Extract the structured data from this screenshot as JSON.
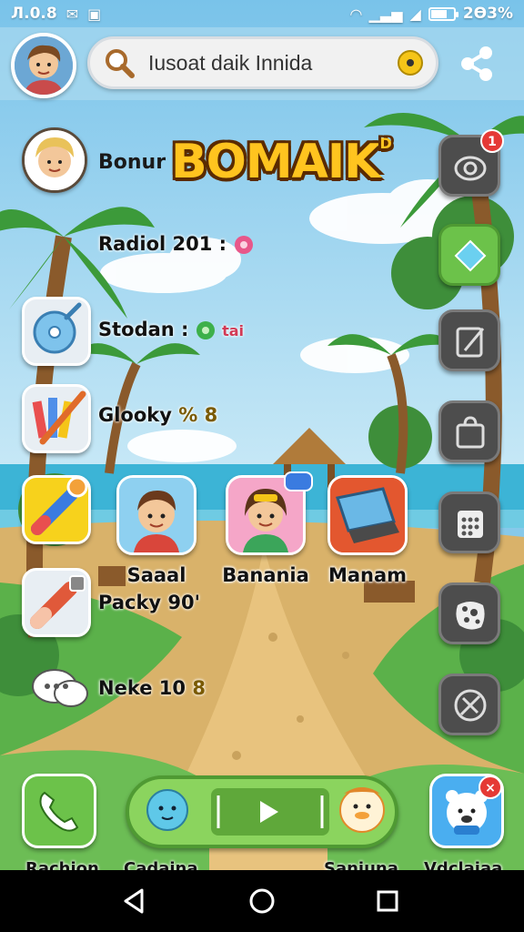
{
  "status_bar": {
    "time": "Л.0.8",
    "battery_text": "2Ѳ3%",
    "battery_level": 0.65,
    "icons": [
      "chat-icon",
      "app-icon",
      "wifi-icon",
      "signal-icon",
      "signal-icon",
      "battery-icon"
    ]
  },
  "header": {
    "search_text": "Iusoat daik Innida",
    "icons": [
      "user-avatar",
      "search-icon",
      "location-pin-icon",
      "share-icon"
    ]
  },
  "profile": {
    "name": "Bonur",
    "title": "BOMAIK",
    "title_mark": "D"
  },
  "stats": [
    {
      "label": "Radiol 201 :",
      "icon": "donut-icon"
    },
    {
      "label": "Stodan :",
      "icon": "green-orb-icon",
      "suffix": "tai"
    },
    {
      "label": "Glooky",
      "suffix": "% 8"
    },
    {
      "label": "Packy 90'"
    },
    {
      "label": "Neke 10",
      "suffix": "8"
    }
  ],
  "apps": [
    {
      "label": "Saaal",
      "icon": "boy-icon"
    },
    {
      "label": "Banania",
      "icon": "girl-icon"
    },
    {
      "label": "Manam",
      "icon": "laptop-icon"
    }
  ],
  "left_tiles": [
    "disc-icon",
    "crayons-icon",
    "crayon-icon",
    "eraser-icon"
  ],
  "rail": {
    "icons": [
      "camera-icon",
      "diamond-icon",
      "board-icon",
      "bag-icon",
      "calendar-icon",
      "map-icon",
      "tools-icon"
    ],
    "badge_count": "1"
  },
  "dock": {
    "labels": [
      "Rachion",
      "Cadaina",
      "Saniuna",
      "Vdclaiaa"
    ],
    "icons": [
      "phone-icon",
      "chat-face-icon",
      "play-icon",
      "duck-icon",
      "polar-bear-icon"
    ]
  },
  "nav": {
    "icons": [
      "back-icon",
      "home-icon",
      "recents-icon"
    ]
  },
  "colors": {
    "accent_green": "#6cc24a",
    "title_yellow": "#ffc41f",
    "badge_red": "#e53935"
  }
}
